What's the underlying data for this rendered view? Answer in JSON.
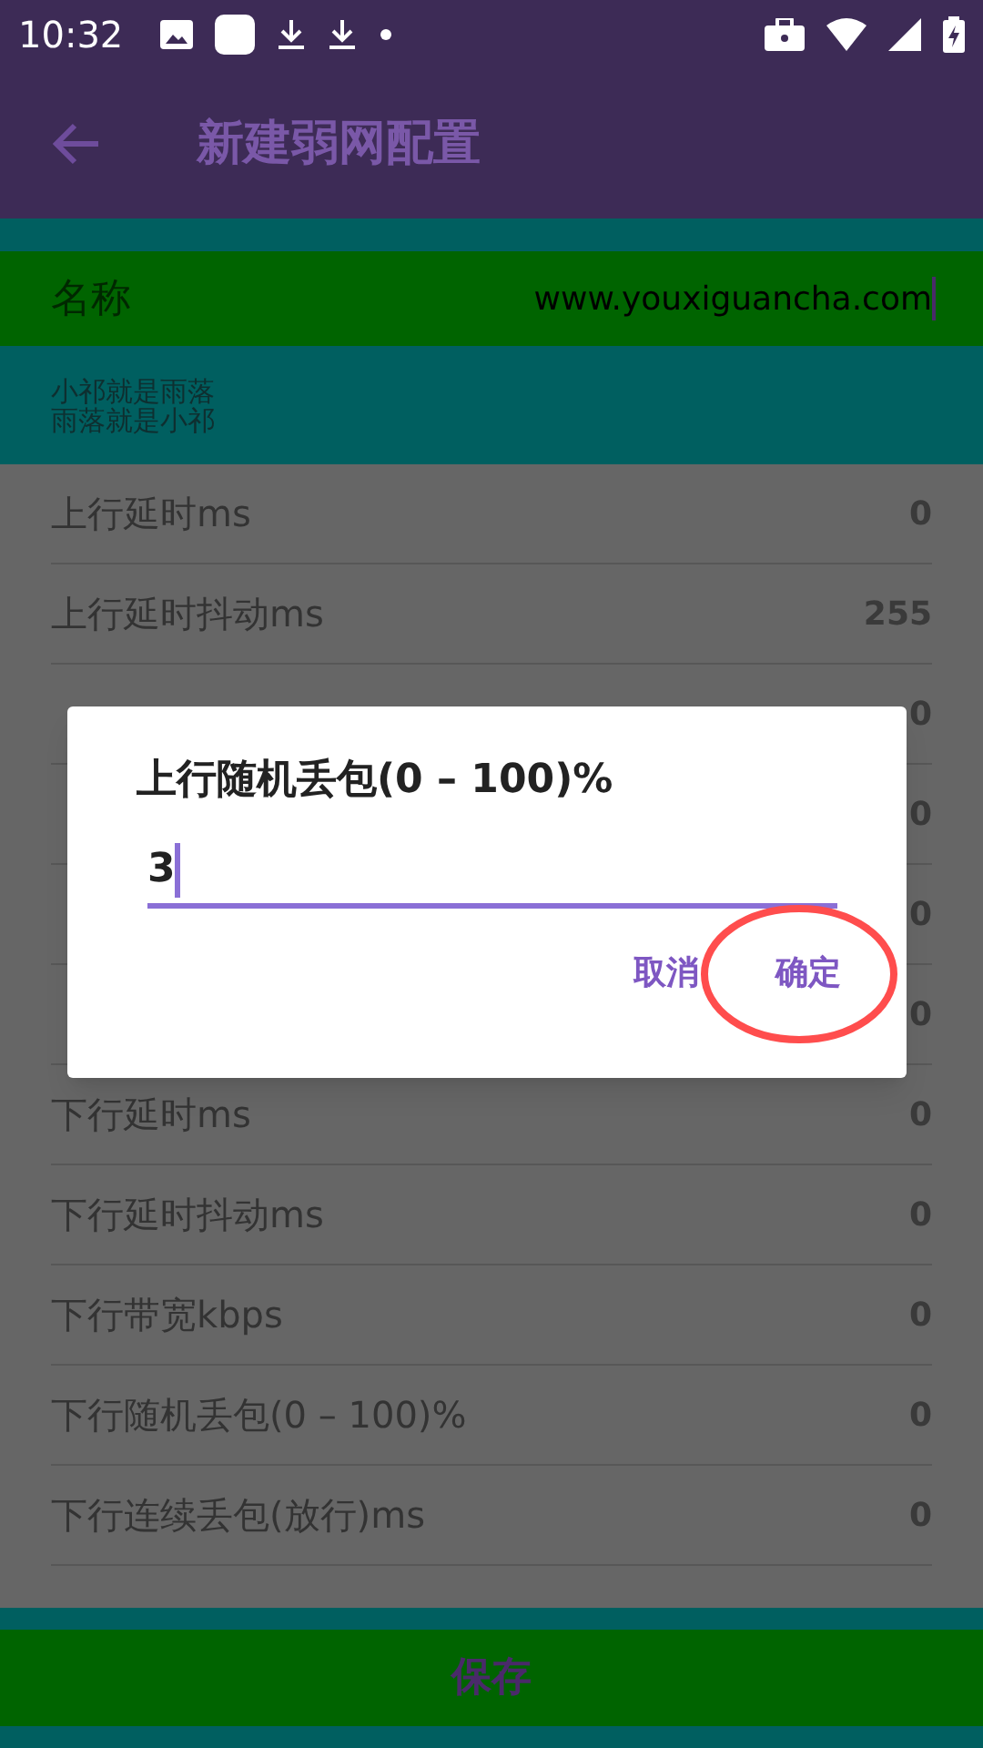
{
  "status_bar": {
    "time": "10:32"
  },
  "app_bar": {
    "title": "新建弱网配置"
  },
  "name_row": {
    "label": "名称",
    "value": "www.youxiguancha.com"
  },
  "hint": [
    "小祁就是雨落",
    "雨落就是小祁"
  ],
  "settings": [
    {
      "label": "上行延时ms",
      "value": "0"
    },
    {
      "label": "上行延时抖动ms",
      "value": "255"
    },
    {
      "value": "0"
    },
    {
      "value": "0"
    },
    {
      "value": "0"
    },
    {
      "value": "0"
    },
    {
      "label": "下行延时ms",
      "value": "0"
    },
    {
      "label": "下行延时抖动ms",
      "value": "0"
    },
    {
      "label": "下行带宽kbps",
      "value": "0"
    },
    {
      "label": "下行随机丢包(0 – 100)%",
      "value": "0"
    },
    {
      "label": "下行连续丢包(放行)ms",
      "value": "0"
    }
  ],
  "save_button": "保存",
  "dialog": {
    "title": "上行随机丢包(0 – 100)%",
    "value": "3",
    "buttons": [
      {
        "label": "取消",
        "highlighted": false
      },
      {
        "label": "确定",
        "highlighted": true
      }
    ]
  }
}
